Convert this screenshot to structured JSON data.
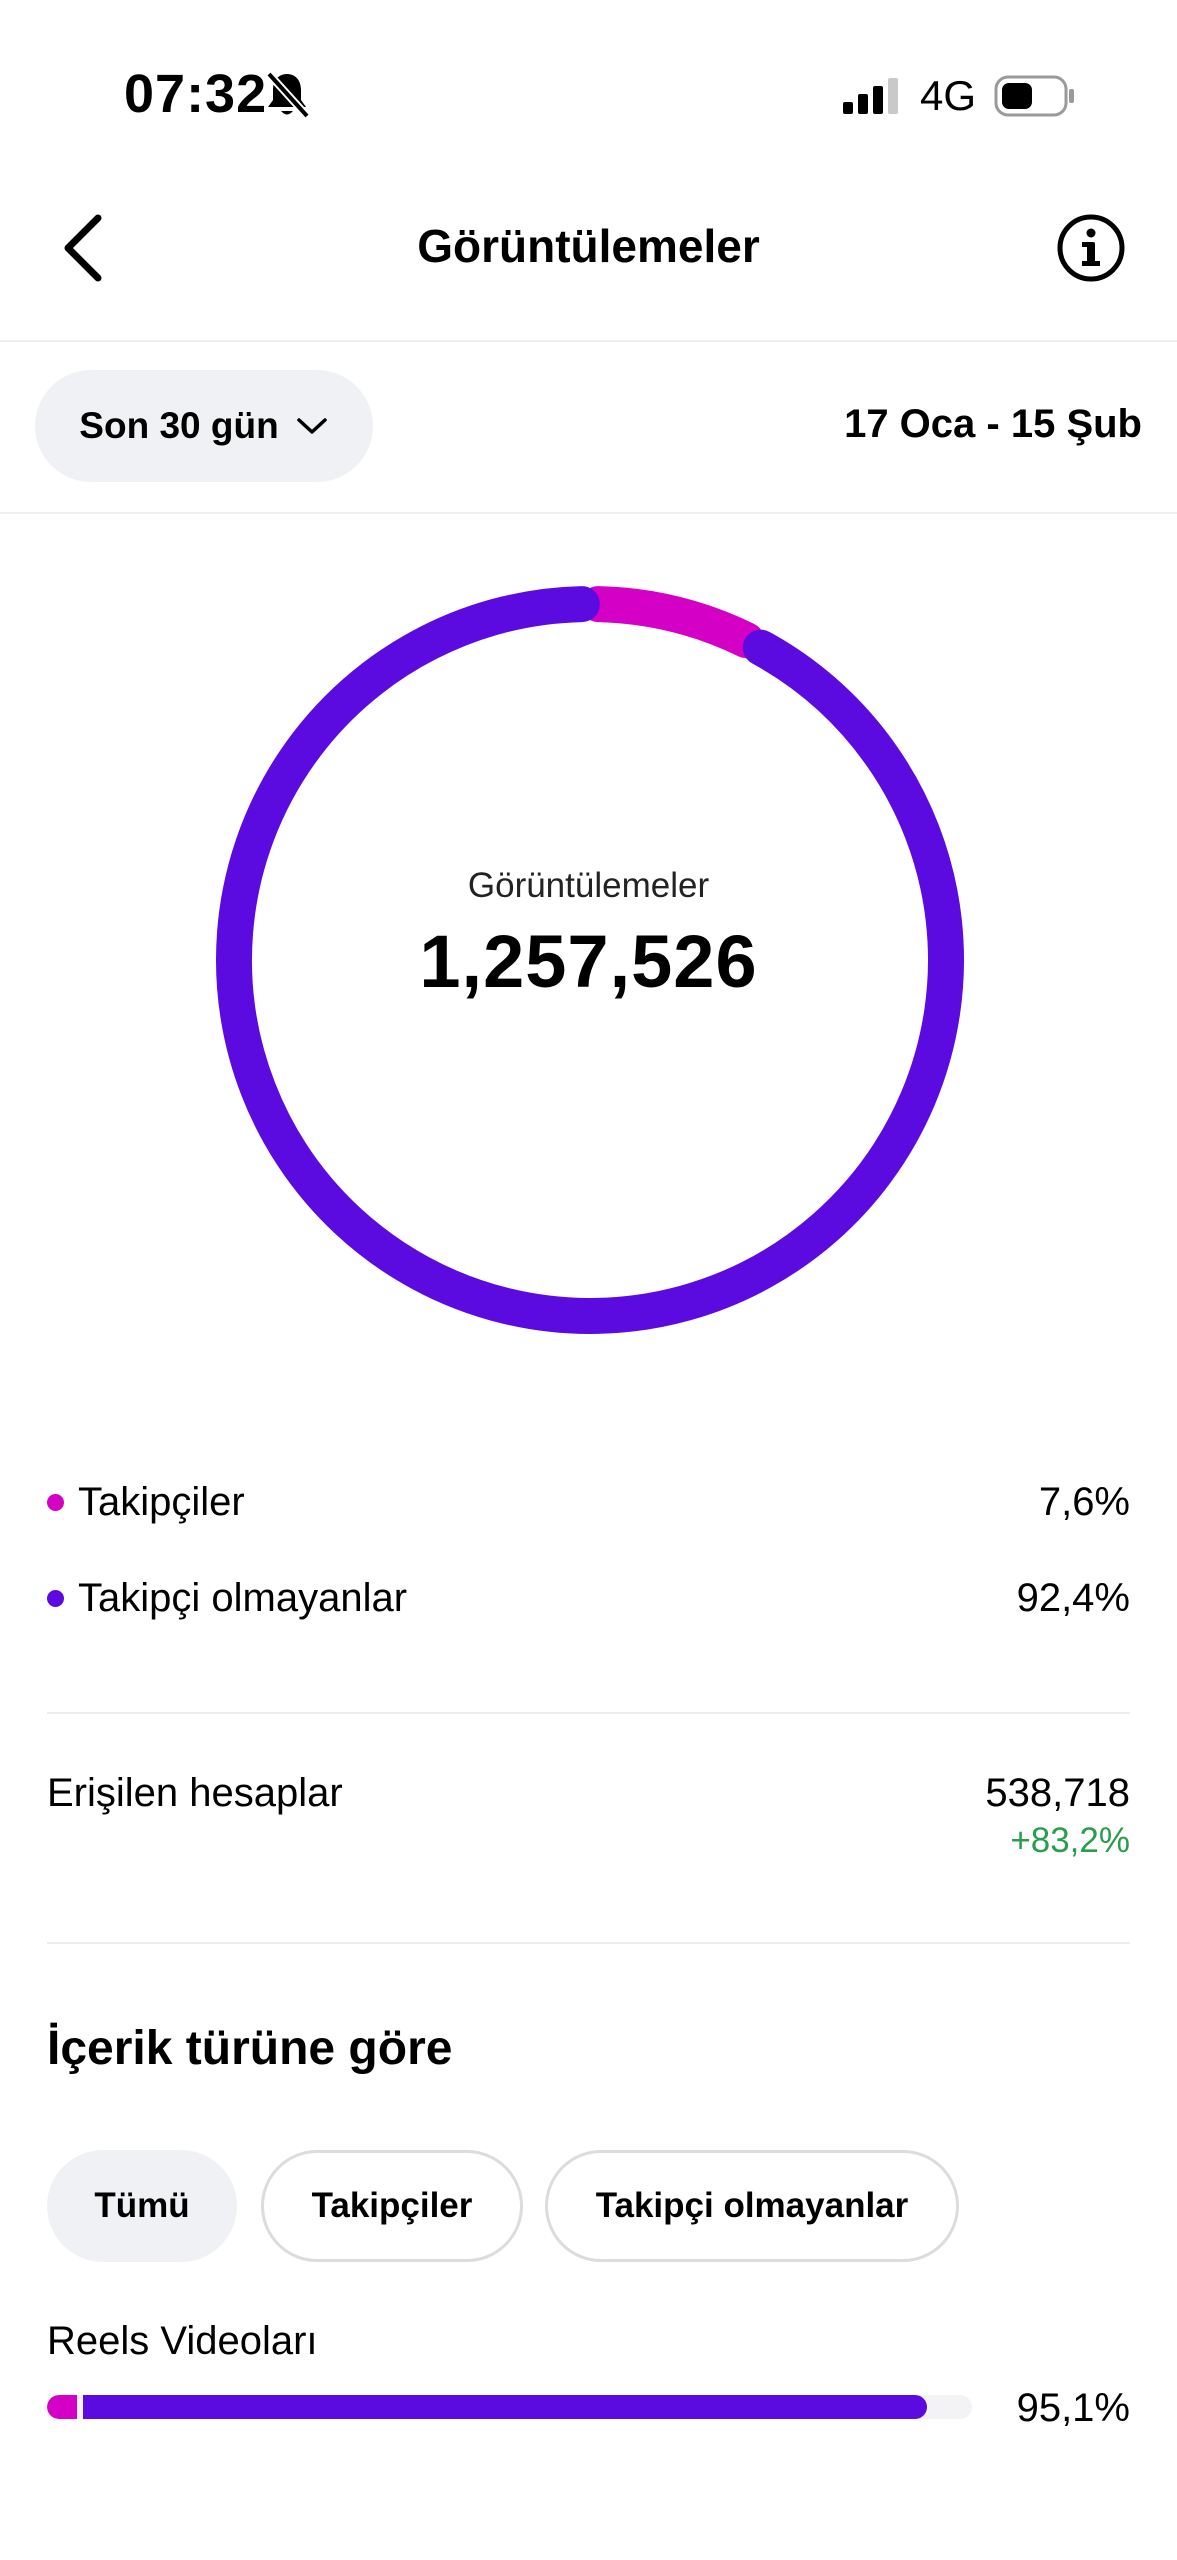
{
  "status_bar": {
    "time": "07:32",
    "network": "4G",
    "icons": [
      "bell-slash-icon",
      "signal-icon",
      "battery-icon"
    ]
  },
  "header": {
    "title": "Görüntülemeler",
    "back_icon": "chevron-left-icon",
    "info_icon": "info-circle-icon"
  },
  "filter": {
    "range_label": "Son 30 gün",
    "range_icon": "chevron-down-icon",
    "date_range": "17 Oca - 15 Şub"
  },
  "colors": {
    "followers": "#d400c6",
    "non_followers": "#5b0be0",
    "positive": "#2a9d4a"
  },
  "summary": {
    "label": "Görüntülemeler",
    "total": "1,257,526"
  },
  "chart_data": {
    "type": "pie",
    "style": "donut",
    "categories": [
      "Takipçiler",
      "Takipçi olmayanlar"
    ],
    "values": [
      7.6,
      92.4
    ],
    "colors": [
      "#d400c6",
      "#5b0be0"
    ],
    "center_label": "Görüntülemeler",
    "center_value": "1,257,526"
  },
  "legend": [
    {
      "label": "Takipçiler",
      "value": "7,6%",
      "color": "#d400c6"
    },
    {
      "label": "Takipçi olmayanlar",
      "value": "92,4%",
      "color": "#5b0be0"
    }
  ],
  "reach": {
    "label": "Erişilen hesaplar",
    "value": "538,718",
    "change": "+83,2%"
  },
  "content_type": {
    "title": "İçerik türüne göre",
    "tabs": [
      "Tümü",
      "Takipçiler",
      "Takipçi olmayanlar"
    ],
    "active_tab": "Tümü",
    "items": [
      {
        "label": "Reels Videoları",
        "percent_text": "95,1%",
        "total_fraction": 0.951,
        "followers_fraction": 0.032
      }
    ]
  }
}
